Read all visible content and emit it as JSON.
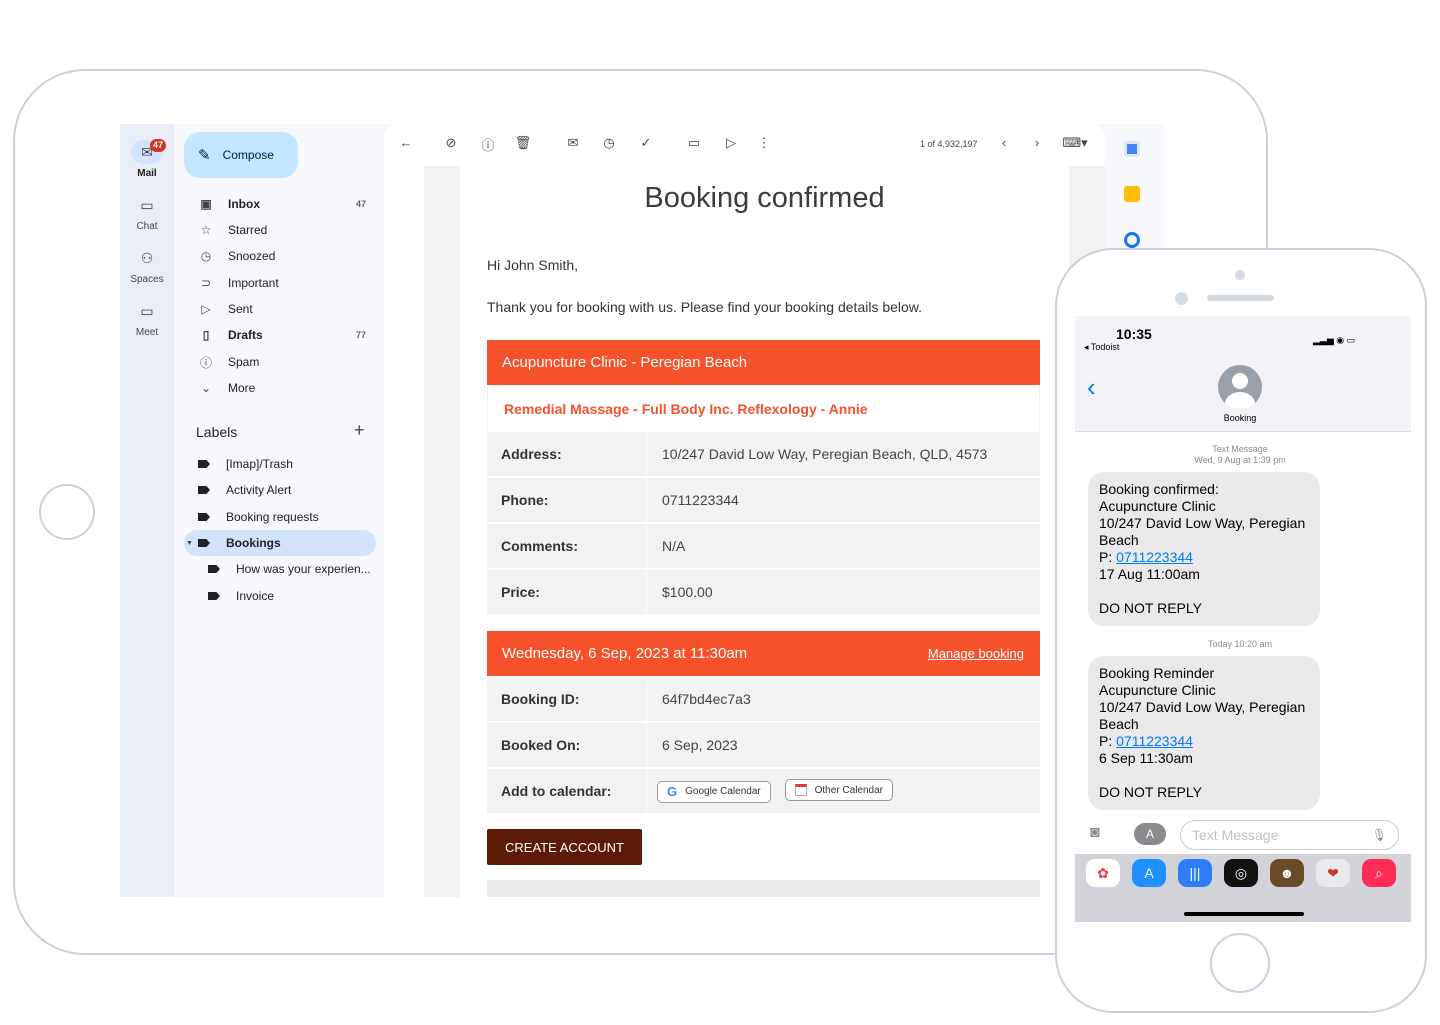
{
  "rail": {
    "items": [
      {
        "label": "Mail",
        "badge": "47"
      },
      {
        "label": "Chat"
      },
      {
        "label": "Spaces"
      },
      {
        "label": "Meet"
      }
    ]
  },
  "nav": {
    "compose": "Compose",
    "items": [
      {
        "label": "Inbox",
        "count": "47"
      },
      {
        "label": "Starred"
      },
      {
        "label": "Snoozed"
      },
      {
        "label": "Important"
      },
      {
        "label": "Sent"
      },
      {
        "label": "Drafts",
        "count": "77"
      },
      {
        "label": "Spam"
      },
      {
        "label": "More"
      }
    ],
    "labels_heading": "Labels",
    "labels": [
      {
        "label": "[Imap]/Trash"
      },
      {
        "label": "Activity Alert"
      },
      {
        "label": "Booking requests"
      },
      {
        "label": "Bookings"
      },
      {
        "label": "How was your experien..."
      },
      {
        "label": "Invoice"
      }
    ]
  },
  "toolbar": {
    "pager": "1 of 4,932,197"
  },
  "email": {
    "title": "Booking confirmed",
    "greeting": "Hi John Smith,",
    "intro": "Thank you for booking with us. Please find your booking details below.",
    "clinic": "Acupuncture Clinic - Peregian Beach",
    "service": "Remedial Massage - Full Body Inc. Reflexology - Annie",
    "details": [
      {
        "key": "Address:",
        "value": "10/247 David Low Way, Peregian Beach, QLD, 4573"
      },
      {
        "key": "Phone:",
        "value": "0711223344"
      },
      {
        "key": "Comments:",
        "value": "N/A"
      },
      {
        "key": "Price:",
        "value": "$100.00"
      }
    ],
    "datetime": "Wednesday, 6 Sep, 2023 at 11:30am",
    "manage": "Manage booking",
    "booking": [
      {
        "key": "Booking ID:",
        "value": "64f7bd4ec7a3"
      },
      {
        "key": "Booked On:",
        "value": "6 Sep, 2023"
      }
    ],
    "calendar_label": "Add to calendar:",
    "google_calendar": "Google Calendar",
    "other_calendar": "Other Calendar",
    "create_account": "CREATE ACCOUNT"
  },
  "phone": {
    "time": "10:35",
    "back_app": "◂ Todoist",
    "contact": "Booking",
    "meta1_type": "Text Message",
    "meta1_time": "Wed, 9 Aug at 1:39 pm",
    "msg1": {
      "l1": "Booking confirmed:",
      "l2": "Acupuncture Clinic",
      "l3": "10/247 David Low Way, Peregian",
      "l4": "Beach",
      "p_prefix": "P: ",
      "phone": "0711223344",
      "l6": "17 Aug 11:00am",
      "l8": "DO NOT REPLY"
    },
    "meta2_time": "Today 10:20 am",
    "msg2": {
      "l1": "Booking Reminder",
      "l2": "Acupuncture Clinic",
      "l3": "10/247 David Low Way, Peregian",
      "l4": "Beach",
      "p_prefix": "P: ",
      "phone": "0711223344",
      "l6": "6 Sep 11:30am",
      "l8": "DO NOT REPLY"
    },
    "input_placeholder": "Text Message"
  }
}
